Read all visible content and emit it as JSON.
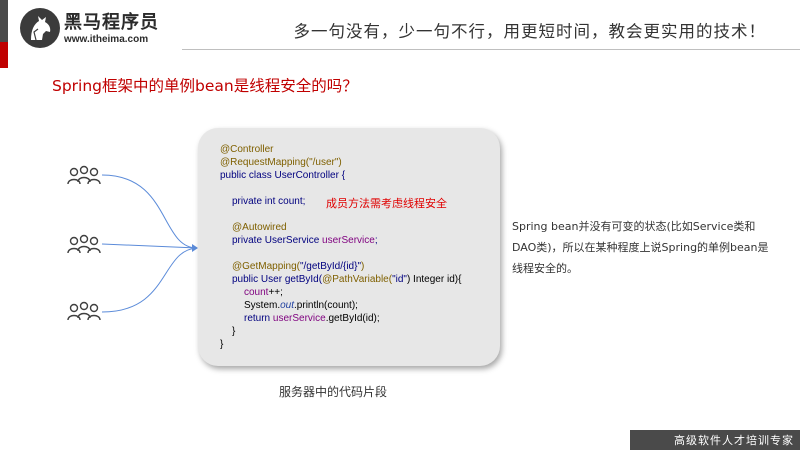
{
  "header": {
    "logo_name": "黑马程序员",
    "logo_url": "www.itheima.com",
    "slogan": "多一句没有，少一句不行，用更短时间，教会更实用的技术！"
  },
  "slide": {
    "title": "Spring框架中的单例bean是线程安全的吗？",
    "code": {
      "l1": "@Controller",
      "l2": "@RequestMapping(\"/user\")",
      "l3": "public class UserController {",
      "l4": "private int count;",
      "l5": "@Autowired",
      "l6_kw": "private",
      "l6_type": " UserService ",
      "l6_field": "userService",
      "l6_end": ";",
      "l7_ann": "@GetMapping(",
      "l7_str": "\"/getById/{id}\"",
      "l7_end": ")",
      "l8_pre": "public User ",
      "l8_m": "getById(",
      "l8_ann": "@PathVariable(",
      "l8_str": "\"id\"",
      "l8_end": ") Integer id){",
      "l9_field": "count",
      "l9_end": "++;",
      "l10_pre": "System.",
      "l10_out": "out",
      "l10_post": ".println(count);",
      "l11_kw": "return ",
      "l11_field": "userService",
      "l11_end": ".getById(id);",
      "l12": "}",
      "l13": "}"
    },
    "annotation_note": "成员方法需考虑线程安全",
    "code_caption": "服务器中的代码片段",
    "description": "Spring bean并没有可变的状态(比如Service类和DAO类)，所以在某种程度上说Spring的单例bean是线程安全的。"
  },
  "footer": {
    "text": "高级软件人才培训专家"
  },
  "colors": {
    "accent": "#c00000",
    "dark": "#4a4a4a",
    "code_bg": "#e7e7e7"
  },
  "icons": [
    "horse-logo-icon",
    "user-group-icon",
    "user-group-icon",
    "user-group-icon"
  ]
}
